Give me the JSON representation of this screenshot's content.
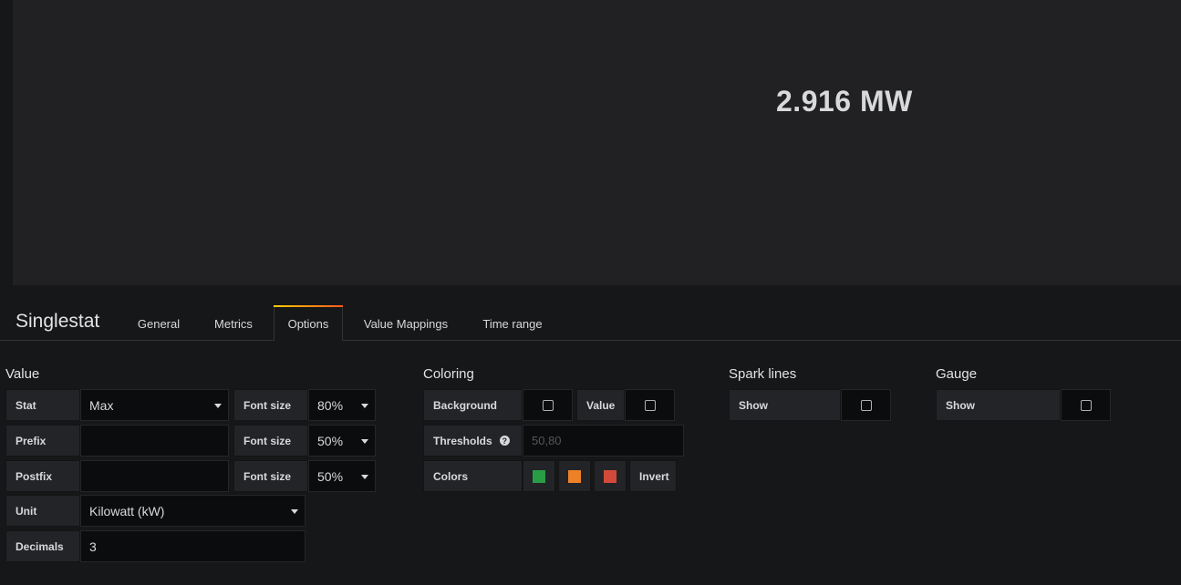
{
  "panel": {
    "value": "2.916 MW"
  },
  "editor": {
    "title": "Singlestat",
    "tabs": [
      "General",
      "Metrics",
      "Options",
      "Value Mappings",
      "Time range"
    ],
    "active_tab": "Options"
  },
  "value": {
    "section_title": "Value",
    "stat_label": "Stat",
    "stat_value": "Max",
    "prefix_label": "Prefix",
    "prefix_value": "",
    "postfix_label": "Postfix",
    "postfix_value": "",
    "font_size_label": "Font size",
    "font_size_1": "80%",
    "font_size_2": "50%",
    "font_size_3": "50%",
    "unit_label": "Unit",
    "unit_value": "Kilowatt (kW)",
    "decimals_label": "Decimals",
    "decimals_value": "3"
  },
  "coloring": {
    "section_title": "Coloring",
    "background_label": "Background",
    "background_checked": false,
    "value_label": "Value",
    "value_checked": false,
    "thresholds_label": "Thresholds",
    "thresholds_placeholder": "50,80",
    "colors_label": "Colors",
    "colors": [
      "#299c46",
      "#ed8128",
      "#d44a3a"
    ],
    "invert_label": "Invert"
  },
  "spark": {
    "section_title": "Spark lines",
    "show_label": "Show",
    "show_checked": false
  },
  "gauge": {
    "section_title": "Gauge",
    "show_label": "Show",
    "show_checked": false
  }
}
